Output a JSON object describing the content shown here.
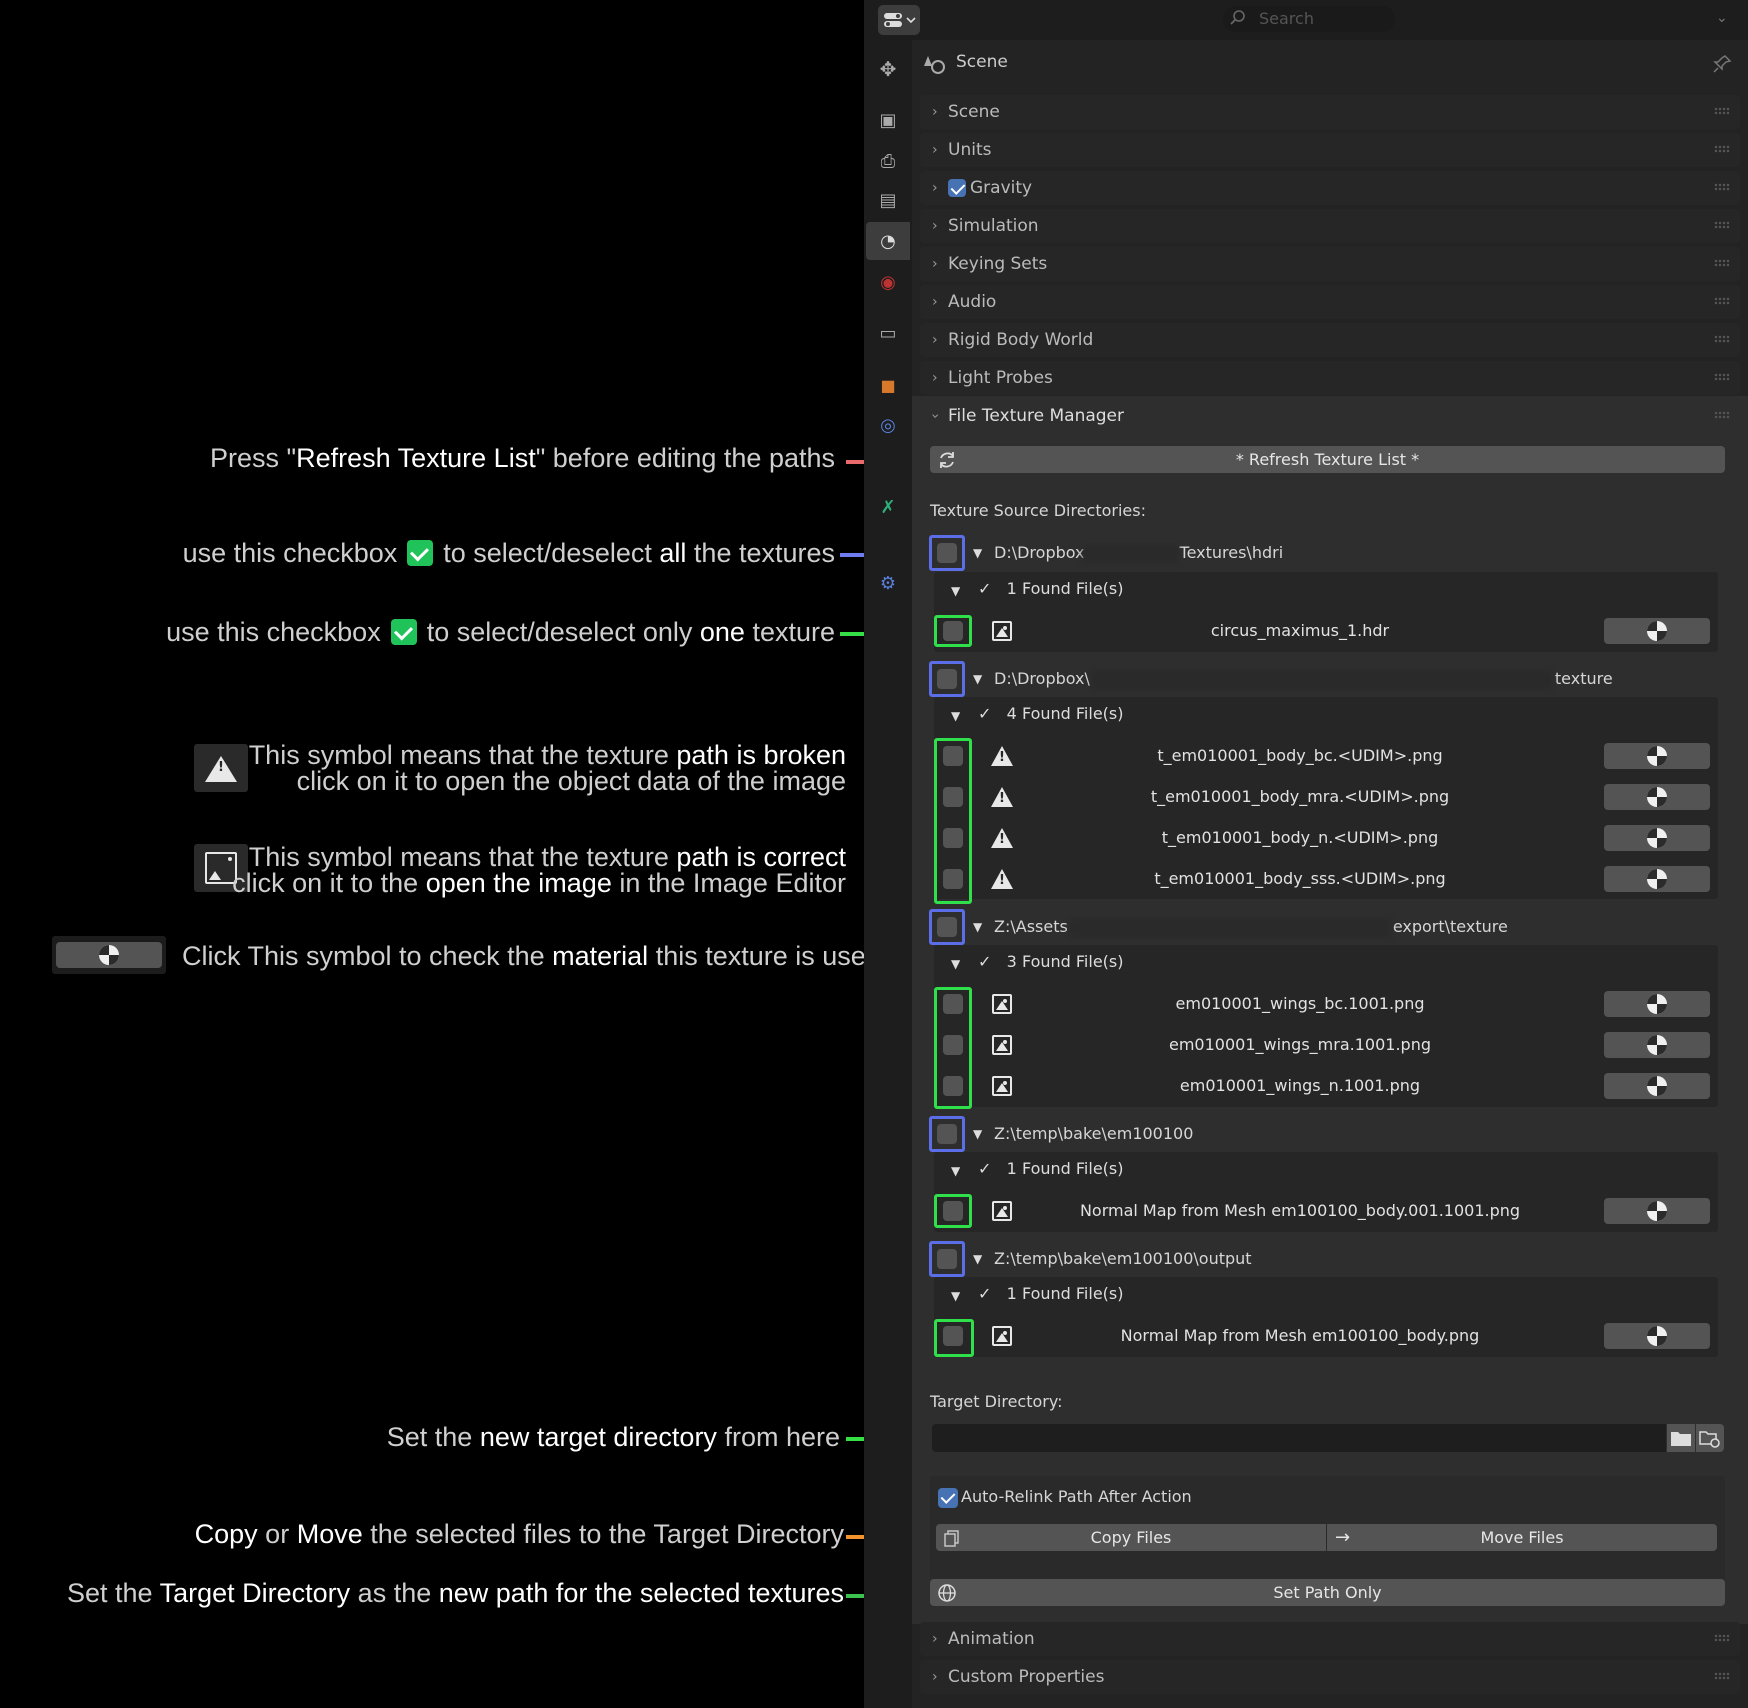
{
  "annotations": {
    "refresh": {
      "pre": "Press \"",
      "bold": "Refresh Texture List",
      "post": "\" before editing the paths"
    },
    "select_all": {
      "pre": "use this checkbox",
      "mid": "to select/deselect",
      "bold": "all",
      "post": "the textures"
    },
    "select_one": {
      "pre": "use this checkbox",
      "mid": "to select/deselect only",
      "bold": "one",
      "post": "texture"
    },
    "broken_line1": {
      "pre": "This symbol means that the texture",
      "bold": "path is broken"
    },
    "broken_line2": "click on it to open the object data of the image",
    "correct_line1": {
      "pre": "This symbol means that the texture",
      "bold": "path is correct"
    },
    "correct_line2": {
      "pre": "click on it to the",
      "bold": "open the image",
      "post": "in the Image Editor"
    },
    "material": {
      "pre": "Click This symbol to check the",
      "bold": "material",
      "post": "this texture is used"
    },
    "target": {
      "pre": "Set the",
      "bold": "new target directory",
      "post": "from here"
    },
    "copy_move": {
      "b1": "Copy",
      "t1": "or",
      "b2": "Move",
      "t2": "the selected files to the Target Directory"
    },
    "set_path": {
      "pre": "Set the",
      "b1": "Target Directory",
      "mid": "as the",
      "b2": "new path for the selected textures"
    }
  },
  "search": {
    "placeholder": "Search"
  },
  "context_title": "Scene",
  "panels_top": [
    "Scene",
    "Units",
    "Gravity",
    "Simulation",
    "Keying Sets",
    "Audio",
    "Rigid Body World",
    "Light Probes"
  ],
  "panel_ftm": {
    "title": "File Texture Manager",
    "refresh_label": "* Refresh Texture List *",
    "source_label": "Texture Source Directories:",
    "directories": [
      {
        "prefix": "D:\\Dropbox",
        "suffix": "Textures\\hdri",
        "found": "1 Found File(s)",
        "files": [
          {
            "name": "circus_maximus_1.hdr",
            "status": "ok"
          }
        ]
      },
      {
        "prefix": "D:\\Dropbox\\",
        "suffix": "texture",
        "found": "4 Found File(s)",
        "files": [
          {
            "name": "t_em010001_body_bc.<UDIM>.png",
            "status": "broken"
          },
          {
            "name": "t_em010001_body_mra.<UDIM>.png",
            "status": "broken"
          },
          {
            "name": "t_em010001_body_n.<UDIM>.png",
            "status": "broken"
          },
          {
            "name": "t_em010001_body_sss.<UDIM>.png",
            "status": "broken"
          }
        ]
      },
      {
        "prefix": "Z:\\Assets",
        "suffix": "export\\texture",
        "found": "3 Found File(s)",
        "files": [
          {
            "name": "em010001_wings_bc.1001.png",
            "status": "ok"
          },
          {
            "name": "em010001_wings_mra.1001.png",
            "status": "ok"
          },
          {
            "name": "em010001_wings_n.1001.png",
            "status": "ok"
          }
        ]
      },
      {
        "prefix": "Z:\\temp\\bake\\em100100",
        "suffix": "",
        "found": "1 Found File(s)",
        "files": [
          {
            "name": "Normal Map from Mesh em100100_body.001.1001.png",
            "status": "ok"
          }
        ]
      },
      {
        "prefix": "Z:\\temp\\bake\\em100100\\output",
        "suffix": "",
        "found": "1 Found File(s)",
        "files": [
          {
            "name": "Normal Map from Mesh em100100_body.png",
            "status": "ok"
          }
        ]
      }
    ],
    "target_label": "Target Directory:",
    "auto_relink_label": "Auto-Relink Path After Action",
    "copy_label": "Copy Files",
    "move_label": "Move Files",
    "set_path_label": "Set Path Only"
  },
  "panels_bottom": [
    "Animation",
    "Custom Properties"
  ],
  "colors": {
    "refresh_arrow": "#e8696b",
    "all_arrow": "#6e7cf0",
    "one_arrow": "#35e046",
    "copy_arrow": "#f3932e",
    "set_arrow": "#3cc24e"
  }
}
